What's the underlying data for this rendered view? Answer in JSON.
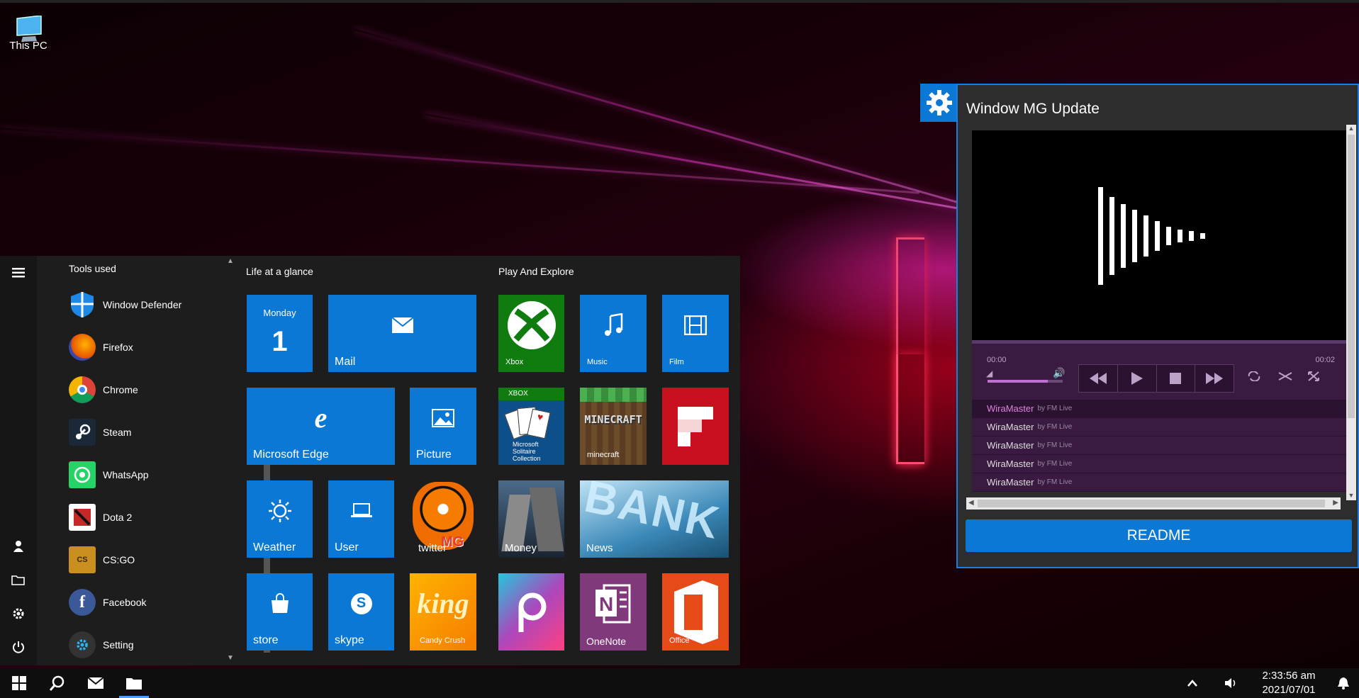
{
  "desktop": {
    "icons": [
      {
        "label": "This PC",
        "icon": "monitor-icon"
      }
    ]
  },
  "start_menu": {
    "app_list_header": "Tools used",
    "apps": [
      {
        "label": "Window Defender",
        "icon": "shield-icon"
      },
      {
        "label": "Firefox",
        "icon": "firefox-icon"
      },
      {
        "label": "Chrome",
        "icon": "chrome-icon"
      },
      {
        "label": "Steam",
        "icon": "steam-icon"
      },
      {
        "label": "WhatsApp",
        "icon": "whatsapp-icon"
      },
      {
        "label": "Dota 2",
        "icon": "dota2-icon"
      },
      {
        "label": "CS:GO",
        "icon": "csgo-icon"
      },
      {
        "label": "Facebook",
        "icon": "facebook-icon"
      },
      {
        "label": "Setting",
        "icon": "gear-icon"
      }
    ],
    "group1_title": "Life at a glance",
    "group2_title": "Play And Explore",
    "tiles": {
      "calendar_day": "Monday",
      "calendar_date": "1",
      "mail": "Mail",
      "edge": "Microsoft Edge",
      "picture": "Picture",
      "weather": "Weather",
      "user": "User",
      "twitter": "twitter",
      "store": "store",
      "skype": "skype",
      "candy": "Candy Crush",
      "xbox": "Xbox",
      "music": "Music",
      "film": "Film",
      "solitaire_top": "XBOX",
      "solitaire": "Microsoft Solitaire Collection",
      "minecraft": "minecraft",
      "money": "Money",
      "news": "News",
      "onenote": "OneNote",
      "office": "Office"
    }
  },
  "window": {
    "title": "Window MG Update",
    "time_start": "00:00",
    "time_end": "00:02",
    "playlist": [
      {
        "name": "WiraMaster",
        "by": "by FM Live"
      },
      {
        "name": "WiraMaster",
        "by": "by FM Live"
      },
      {
        "name": "WiraMaster",
        "by": "by FM Live"
      },
      {
        "name": "WiraMaster",
        "by": "by FM Live"
      },
      {
        "name": "WiraMaster",
        "by": "by FM Live"
      }
    ],
    "readme_label": "README"
  },
  "taskbar": {
    "time": "2:33:56 am",
    "date": "2021/07/01"
  },
  "colors": {
    "accent": "#0a78d4",
    "player": "#3a1a40"
  }
}
